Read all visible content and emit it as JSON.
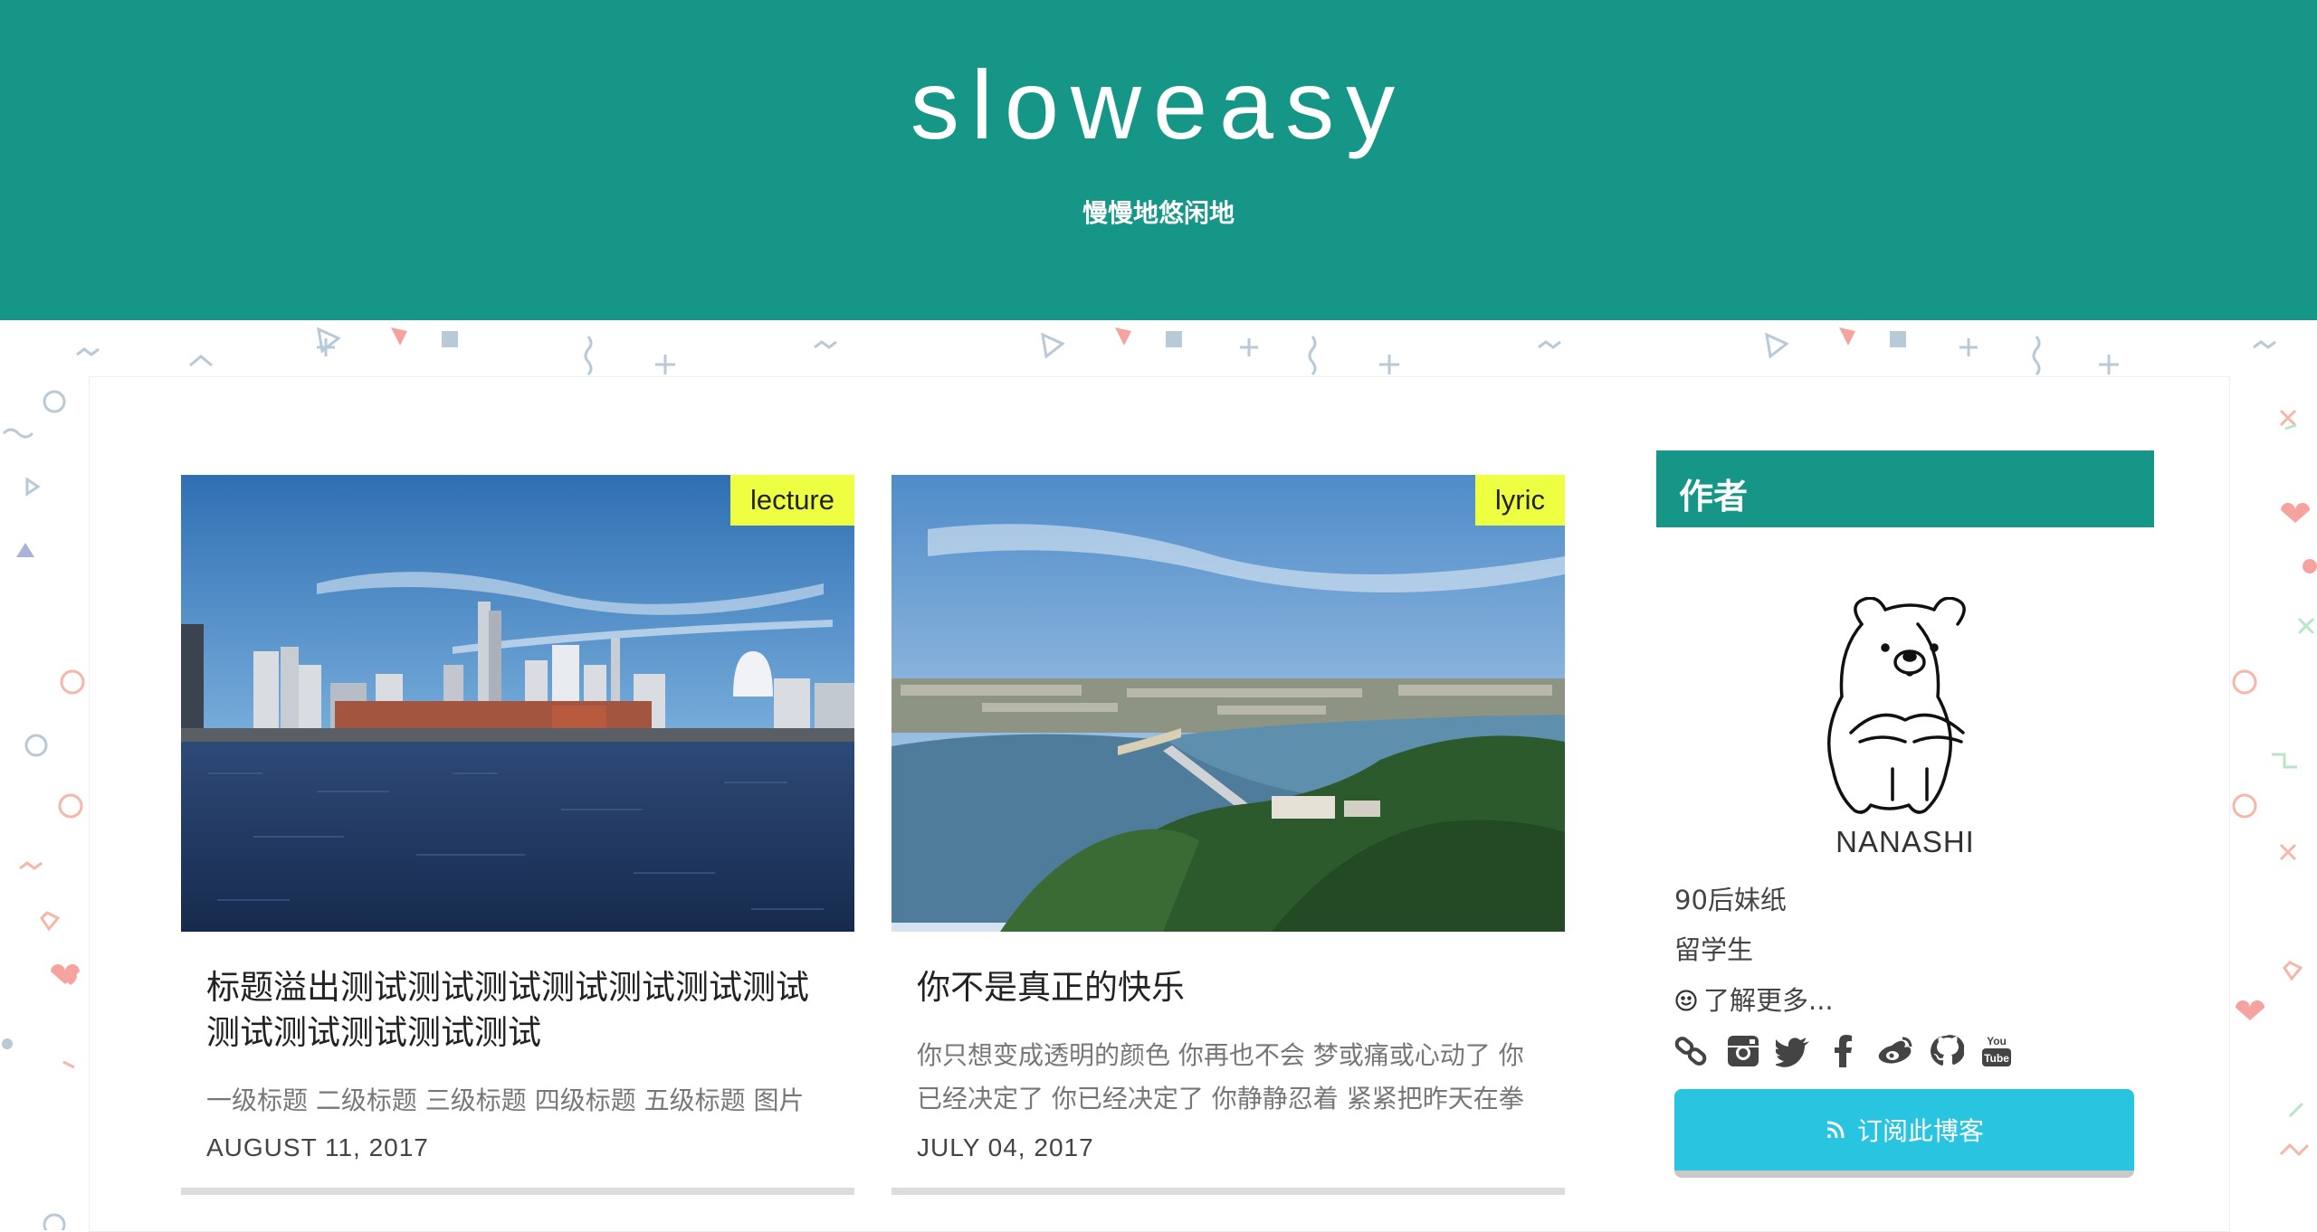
{
  "site": {
    "title": "sloweasy",
    "subtitle": "慢慢地悠闲地"
  },
  "colors": {
    "header": "#169686",
    "tag": "#eeff41",
    "subscribe": "#29c5e0"
  },
  "posts": [
    {
      "tag": "lecture",
      "title": "标题溢出测试测试测试测试测试测试测试测试测试测试测试测试",
      "excerpt": "一级标题 二级标题 三级标题 四级标题 五级标题 图片",
      "date": "AUGUST 11, 2017",
      "image": "yokohama-harbor-skyline"
    },
    {
      "tag": "lyric",
      "title": "你不是真正的快乐",
      "excerpt": "你只想变成透明的颜色 你再也不会 梦或痛或心动了 你已经决定了 你已经决定了 你静静忍着 紧紧把昨天在拳",
      "date": "JULY 04, 2017",
      "image": "coastal-bay-aerial"
    }
  ],
  "sidebar": {
    "heading": "作者",
    "avatar_icon": "bear-avatar-icon",
    "name": "NANASHI",
    "lines": [
      "90后妹纸",
      "留学生"
    ],
    "more_link": "了解更多...",
    "social_icons": [
      "link-icon",
      "instagram-icon",
      "twitter-icon",
      "facebook-icon",
      "weibo-icon",
      "github-icon",
      "youtube-icon"
    ],
    "subscribe_label": "订阅此博客"
  }
}
